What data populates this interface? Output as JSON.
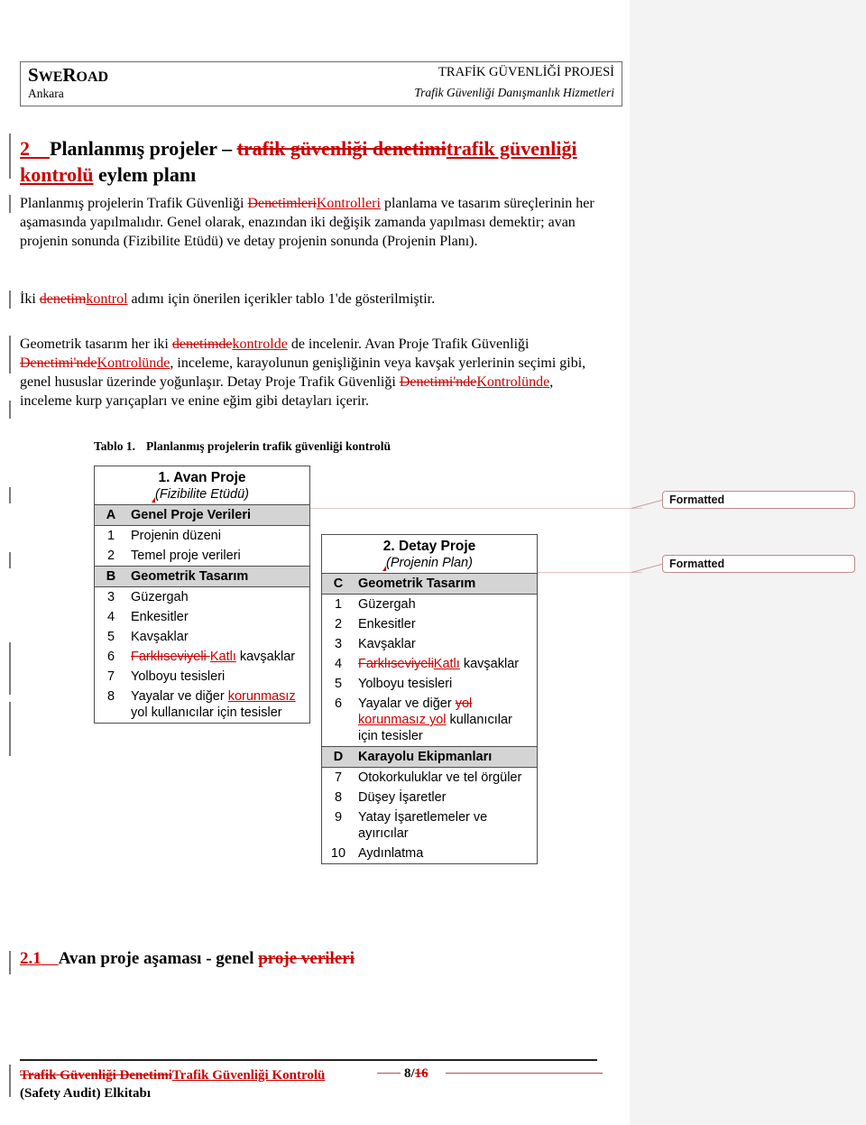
{
  "header": {
    "company_main": "SweRoad",
    "company_small_caps": "S",
    "city": "Ankara",
    "project_title": "TRAFİK GÜVENLİĞİ PROJESİ",
    "project_subtitle": "Trafik Güvenliği Danışmanlık Hizmetleri"
  },
  "headings": {
    "h1_number": "2",
    "h1_before": "Planlanmış projeler – ",
    "h1_deleted": "trafik güvenliği denetimi",
    "h1_inserted": "trafik güvenliği kontrolü",
    "h1_after": " eylem planı",
    "h2_number": "2.1",
    "h2_before": "Avan proje aşaması - genel ",
    "h2_deleted": "proje verileri"
  },
  "paragraphs": {
    "intro_part1": "Planlanmış projelerin Trafik Güvenliği ",
    "intro_deleted": "Denetimleri",
    "intro_inserted": "Kontrolleri",
    "intro_part2": " planlama ve tasarım süreçlerinin her aşamasında yapılmalıdır. Genel olarak, enazından iki değişik zamanda yapılması demektir; avan projenin sonunda (Fizibilite Etüdü) ve detay projenin sonunda (Projenin Planı).",
    "iki_part1": "İki ",
    "iki_deleted": "denetim",
    "iki_inserted": "kontrol",
    "iki_part2": " adımı için önerilen içerikler tablo 1'de gösterilmiştir.",
    "geom_part1": "Geometrik tasarım her iki ",
    "geom_del1": "denetimde",
    "geom_ins1": "kontrolde",
    "geom_part2": " de incelenir. Avan Proje Trafik Güvenliği ",
    "geom_del2": "Denetimi'nde",
    "geom_ins2": "Kontrolünde",
    "geom_part3": ", inceleme, karayolunun genişliğinin veya kavşak yerlerinin seçimi gibi, genel hususlar üzerinde yoğunlaşır. Detay Proje Trafik Güvenliği ",
    "geom_del3": "Denetimi'nde",
    "geom_ins3": "Kontrolünde",
    "geom_part4": ", inceleme kurp yarıçapları ve enine eğim gibi detayları içerir."
  },
  "table_caption": {
    "label": "Tablo 1.",
    "text": "Planlanmış projelerin trafik güvenliği kontrolü"
  },
  "table_avan": {
    "title_line1": "1.  Avan Proje",
    "title_line2": "(Fizibilite Etüdü)",
    "rows": [
      {
        "type": "group",
        "idx": "A",
        "label": "Genel Proje Verileri"
      },
      {
        "type": "item",
        "idx": "1",
        "label": "Projenin düzeni"
      },
      {
        "type": "item",
        "idx": "2",
        "label": "Temel proje verileri"
      },
      {
        "type": "group",
        "idx": "B",
        "label": "Geometrik Tasarım"
      },
      {
        "type": "item",
        "idx": "3",
        "label": "Güzergah"
      },
      {
        "type": "item",
        "idx": "4",
        "label": "Enkesitler"
      },
      {
        "type": "item",
        "idx": "5",
        "label": "Kavşaklar"
      },
      {
        "type": "tracked",
        "idx": "6",
        "deleted": "Farklıseviyeli ",
        "inserted": "Katlı",
        "after": " kavşaklar"
      },
      {
        "type": "item",
        "idx": "7",
        "label": "Yolboyu tesisleri"
      },
      {
        "type": "tracked2",
        "idx": "8",
        "before": "Yayalar ve diğer ",
        "inserted": "korunmasız ",
        "after": "yol kullanıcılar için tesisler"
      }
    ]
  },
  "table_detay": {
    "title_line1": "2. Detay Proje",
    "title_line2": "(Projenin Plan)",
    "rows": [
      {
        "type": "group",
        "idx": "C",
        "label": "Geometrik Tasarım"
      },
      {
        "type": "item",
        "idx": "1",
        "label": "Güzergah"
      },
      {
        "type": "item",
        "idx": "2",
        "label": "Enkesitler"
      },
      {
        "type": "item",
        "idx": "3",
        "label": "Kavşaklar"
      },
      {
        "type": "tracked",
        "idx": "4",
        "deleted": "Farklıseviyeli",
        "inserted": "Katlı",
        "after": " kavşaklar"
      },
      {
        "type": "item",
        "idx": "5",
        "label": "Yolboyu tesisleri"
      },
      {
        "type": "tracked3",
        "idx": "6",
        "before": "Yayalar ve diğer ",
        "deleted": "yol",
        "inserted": "korunmasız yol",
        "after": " kullanıcılar için tesisler"
      },
      {
        "type": "group",
        "idx": "D",
        "label": "Karayolu Ekipmanları"
      },
      {
        "type": "item",
        "idx": "7",
        "label": "Otokorkuluklar ve tel örgüler"
      },
      {
        "type": "item",
        "idx": "8",
        "label": "Düşey İşaretler"
      },
      {
        "type": "item",
        "idx": "9",
        "label": "Yatay İşaretlemeler ve ayırıcılar"
      },
      {
        "type": "item",
        "idx": "10",
        "label": "Aydınlatma"
      }
    ]
  },
  "callouts": {
    "formatted_1": "Formatted",
    "formatted_2": "Formatted"
  },
  "footer": {
    "deleted_title": "Trafik Güvenliği Denetimi",
    "inserted_title": "Trafik Güvenliği Kontrolü",
    "subtitle": "(Safety Audit) Elkitabı",
    "page_current": "8/",
    "page_total_deleted": "16"
  },
  "colors": {
    "tracked_change": "#cc0000",
    "group_row_bg": "#d4d4d4",
    "page_bg": "#ffffff",
    "surround_bg": "#f3f3f3",
    "callout_border": "#c08a8a"
  }
}
